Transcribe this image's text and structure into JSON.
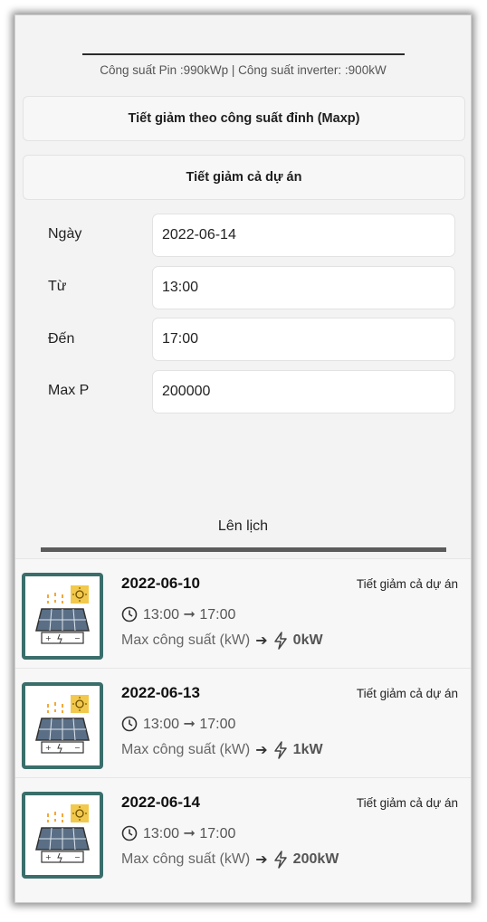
{
  "header": {
    "capacity_text": "Công suất Pin :990kWp | Công suất inverter: :900kW"
  },
  "options": {
    "max_peak_label": "Tiết giảm theo công suất đỉnh (Maxp)",
    "whole_project_label": "Tiết giảm cả dự án"
  },
  "form": {
    "date_label": "Ngày",
    "date_value": "2022-06-14",
    "from_label": "Từ",
    "from_value": "13:00",
    "to_label": "Đến",
    "to_value": "17:00",
    "maxp_label": "Max P",
    "maxp_value": "200000"
  },
  "schedule_label": "Lên lịch",
  "entries": [
    {
      "date": "2022-06-10",
      "type": "Tiết giảm cả dự án",
      "time": "13:00 ➞ 17:00",
      "max_label": "Max công suất (kW)",
      "max_value": "0kW"
    },
    {
      "date": "2022-06-13",
      "type": "Tiết giảm cả dự án",
      "time": "13:00 ➞ 17:00",
      "max_label": "Max công suất (kW)",
      "max_value": "1kW"
    },
    {
      "date": "2022-06-14",
      "type": "Tiết giảm cả dự án",
      "time": "13:00 ➞ 17:00",
      "max_label": "Max công suất (kW)",
      "max_value": "200kW"
    }
  ],
  "icons": {
    "thumbnail": "solar-panel-icon",
    "time": "clock-icon",
    "arrow": "arrow-right-icon",
    "power": "lightning-icon"
  },
  "colors": {
    "thumbnail_border": "#3a6e6b",
    "sun_badge": "#f2c94c"
  }
}
